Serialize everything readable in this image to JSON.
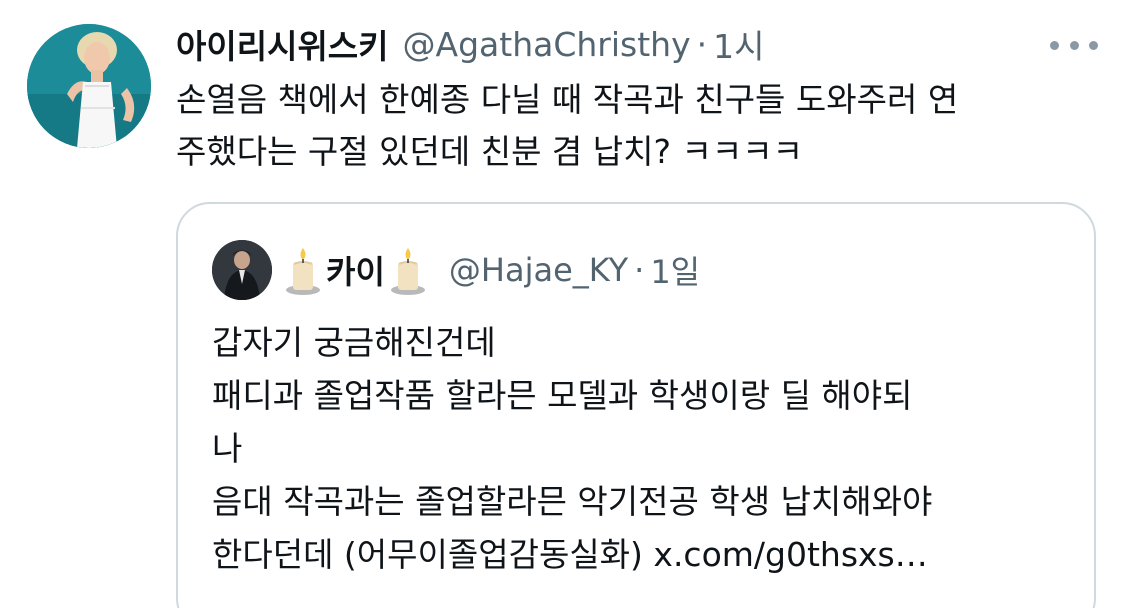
{
  "tweet": {
    "author_name": "아이리시위스키",
    "author_handle": "@AgathaChristhy",
    "separator": "·",
    "time": "1시",
    "more_icon": "more-horizontal-icon",
    "body_lines": [
      "손열음 책에서 한예종 다닐 때 작곡과 친구들 도와주러 연",
      "주했다는 구절 있던데 친분 겸 납치? ㅋㅋㅋㅋ"
    ]
  },
  "quoted_tweet": {
    "author_name": "카이",
    "author_handle": "@Hajae_KY",
    "separator": "·",
    "time": "1일",
    "name_emoji": "candle-emoji",
    "body_lines": [
      "갑자기 궁금해진건데",
      "패디과 졸업작품 할라믄 모델과 학생이랑 딜 해야되",
      "나",
      "음대 작곡과는 졸업할라믄 악기전공 학생 납치해와야",
      "한다던데 (어무이졸업감동실화) x.com/g0thsxs…"
    ]
  },
  "colors": {
    "text": "#0f1419",
    "secondary": "#536471",
    "border": "#cfd9de",
    "avatar_bg": "#1f8f9a"
  }
}
